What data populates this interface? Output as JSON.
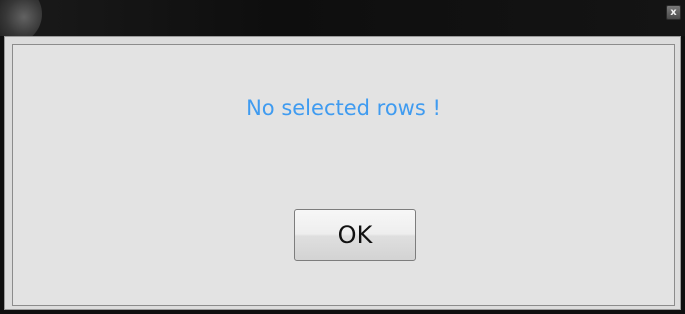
{
  "dialog": {
    "close_glyph": "x",
    "message": "No selected rows !",
    "ok_label": "OK"
  },
  "colors": {
    "message_text": "#3f9bf0",
    "client_background": "#e3e3e3",
    "titlebar": "#111111"
  },
  "icons": {
    "close": "close-icon",
    "window_orb": "window-orb-icon"
  }
}
